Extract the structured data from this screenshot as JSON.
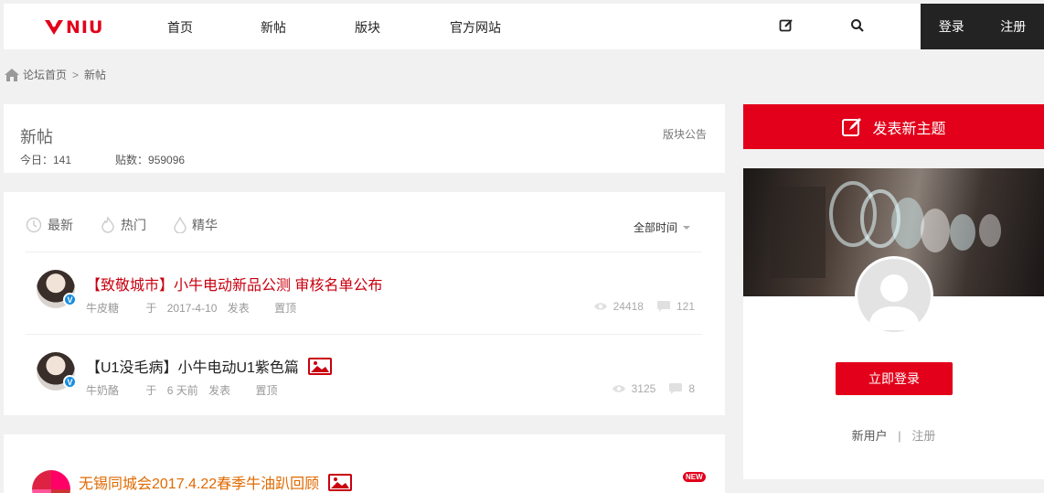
{
  "header": {
    "logo_text": "NIU",
    "nav": [
      "首页",
      "新帖",
      "版块",
      "官方网站"
    ],
    "login": "登录",
    "register": "注册",
    "brand_color": "#e2001a"
  },
  "breadcrumb": {
    "home": "论坛首页",
    "sep": ">",
    "current": "新帖"
  },
  "forum": {
    "title": "新帖",
    "notice": "版块公告",
    "today": "今日：141",
    "posts": "贴数：959096"
  },
  "filters": {
    "latest": "最新",
    "hot": "热门",
    "digest": "精华",
    "time": "全部时间"
  },
  "threads": [
    {
      "title": "【致敬城市】小牛电动新品公测 审核名单公布",
      "author": "牛皮糖",
      "time_prefix": "于",
      "time": "2017-4-10",
      "time_suffix": "发表",
      "tag": "置顶",
      "views": "24418",
      "replies": "121"
    },
    {
      "title": "【U1没毛病】小牛电动U1紫色篇",
      "author": "牛奶酪",
      "time_prefix": "于",
      "time": "6 天前",
      "time_suffix": "发表",
      "tag": "置顶",
      "views": "3125",
      "replies": "8"
    }
  ],
  "thread3": {
    "title": "无锡同城会2017.4.22春季牛油趴回顾",
    "badge": "NEW"
  },
  "sidebar": {
    "post_button": "发表新主题",
    "login_button": "立即登录",
    "new_user": "新用户",
    "divider": "|",
    "register": "注册"
  },
  "icons": [
    "niu-logo-icon",
    "edit-icon",
    "search-icon",
    "home-icon",
    "clock-icon",
    "fire-icon",
    "drop-icon",
    "eye-icon",
    "comment-icon",
    "image-icon",
    "compose-icon",
    "verified-icon"
  ]
}
